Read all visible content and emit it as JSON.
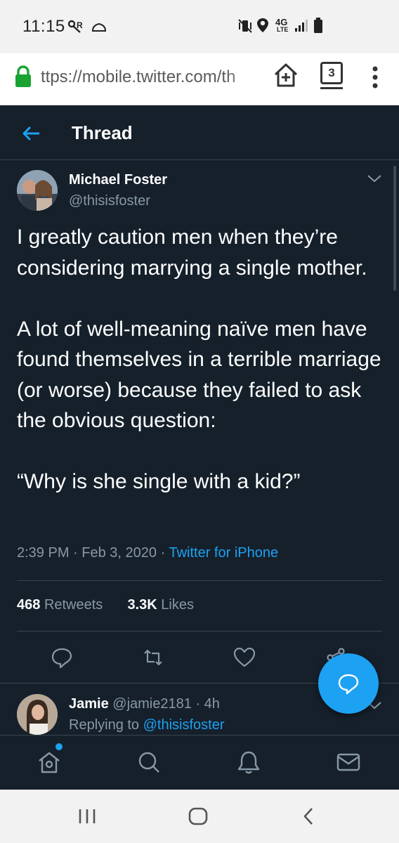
{
  "status_bar": {
    "time": "11:15",
    "network": "4G",
    "network_sub": "LTE",
    "icons": [
      "vpn-key-icon",
      "cloud-icon",
      "vibrate-mute-icon",
      "location-icon",
      "signal-icon",
      "battery-icon"
    ]
  },
  "browser": {
    "url": "ttps://mobile.twitter.com/th",
    "tab_count": "3",
    "icons": [
      "lock-icon",
      "add-to-home-icon",
      "tabs-icon",
      "overflow-menu-icon"
    ]
  },
  "header": {
    "title": "Thread",
    "back_icon": "back-arrow-icon"
  },
  "tweet": {
    "author_name": "Michael Foster",
    "author_handle": "@thisisfoster",
    "text": "I greatly caution men when they’re considering marrying a single mother.\n\nA lot of well-meaning naïve men have found themselves in a terrible marriage (or worse) because they failed to ask the obvious question:\n\n“Why is she single with a kid?”",
    "time": "2:39 PM",
    "date": "Feb 3, 2020",
    "separator": "·",
    "source": "Twitter for iPhone",
    "retweets_count": "468",
    "retweets_label": "Retweets",
    "likes_count": "3.3K",
    "likes_label": "Likes",
    "actions": [
      "reply-icon",
      "retweet-icon",
      "like-icon",
      "share-icon"
    ]
  },
  "reply": {
    "author_name": "Jamie",
    "author_handle": "@jamie2181",
    "separator": "·",
    "age": "4h",
    "replying_prefix": "Replying to",
    "replying_to": "@thisisfoster"
  },
  "fab": {
    "icon": "compose-reply-icon"
  },
  "tabbar": {
    "items": [
      "home-icon",
      "search-icon",
      "notifications-icon",
      "messages-icon"
    ]
  },
  "android_nav": {
    "items": [
      "recents-icon",
      "home-button-icon",
      "back-icon"
    ]
  },
  "colors": {
    "background": "#15202b",
    "accent": "#1da1f2",
    "secondary_text": "#8899a6",
    "border": "#38444d",
    "lock_green": "#1aa332"
  }
}
